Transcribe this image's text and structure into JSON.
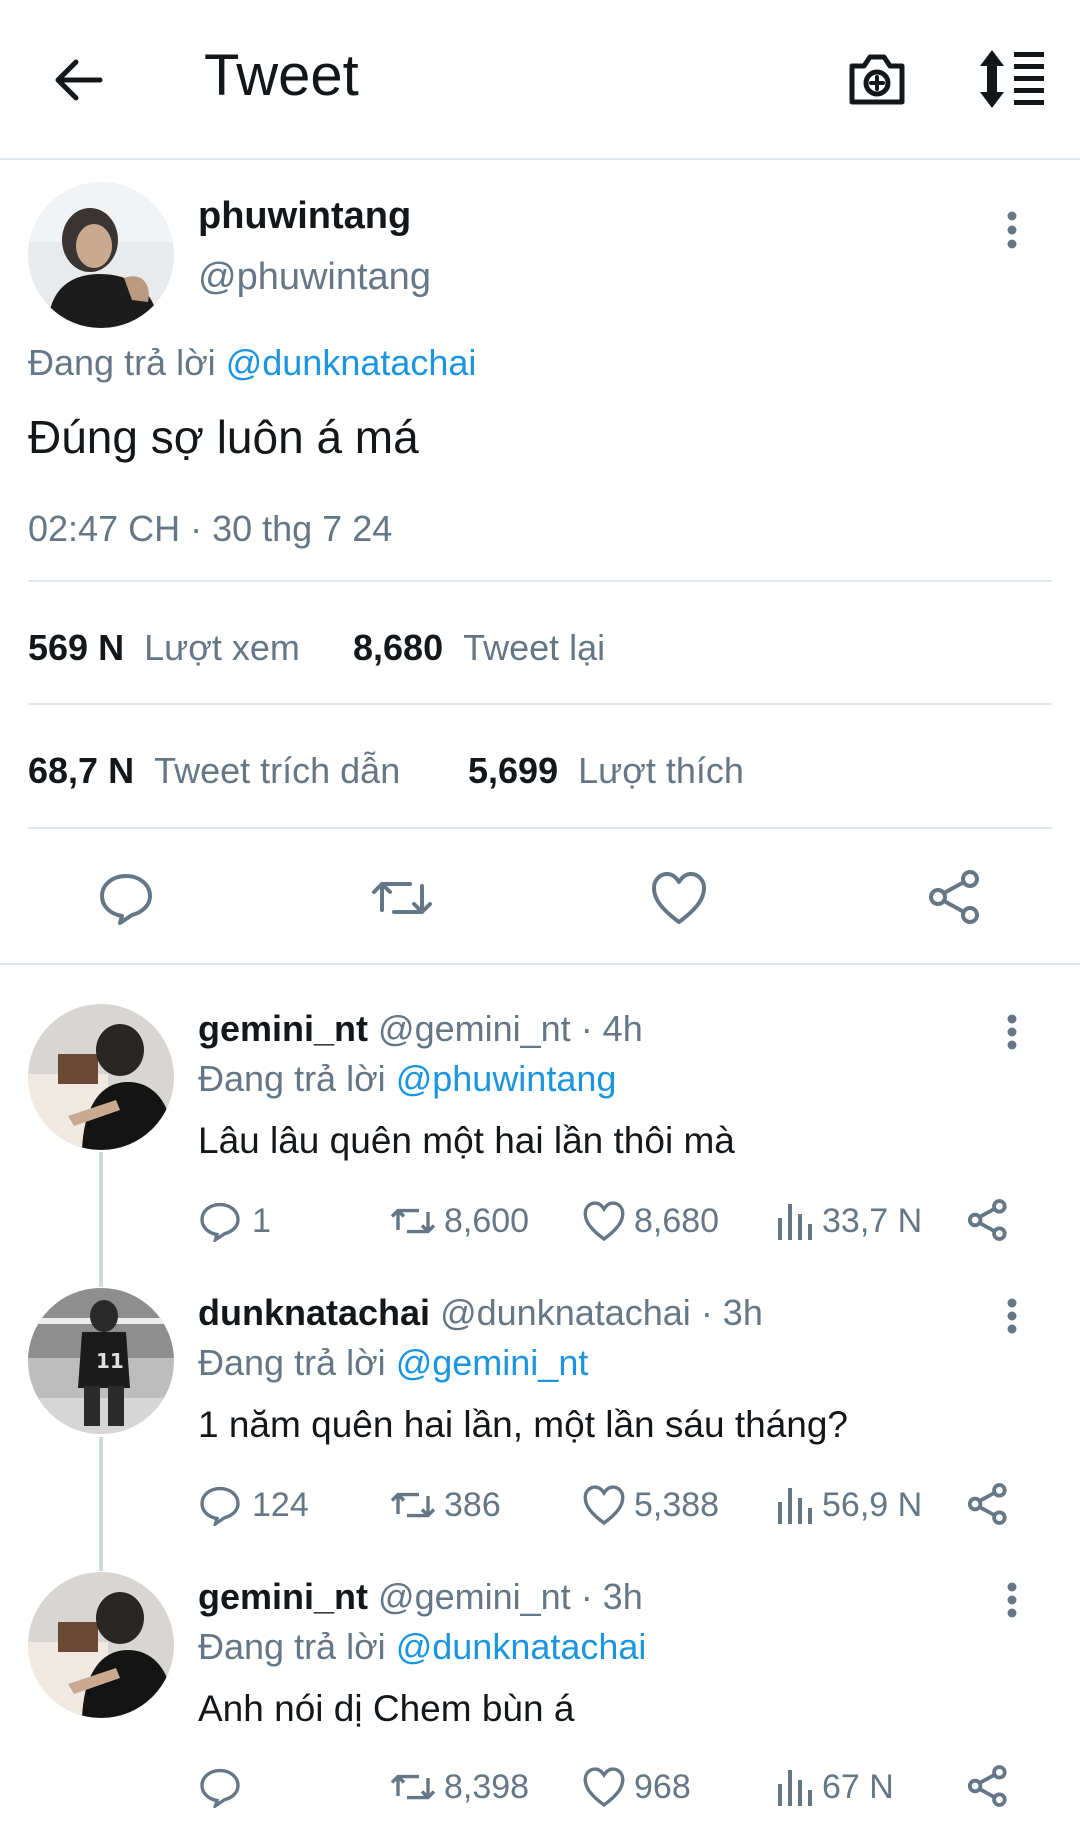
{
  "header": {
    "title": "Tweet",
    "back_icon": "arrow-left-icon",
    "camera_icon": "camera-add-icon",
    "sort_icon": "sort-list-icon"
  },
  "main_tweet": {
    "display_name": "phuwintang",
    "handle": "@phuwintang",
    "replying_label": "Đang trả lời",
    "replying_to": "@dunknatachai",
    "text": "Đúng sợ luôn á má",
    "timestamp": "02:47 CH · 30 thg 7 24",
    "stats": [
      {
        "value": "569 N",
        "label": "Lượt xem"
      },
      {
        "value": "8,680",
        "label": "Tweet lại"
      },
      {
        "value": "68,7 N",
        "label": "Tweet trích dẫn"
      },
      {
        "value": "5,699",
        "label": "Lượt thích"
      }
    ],
    "actions": [
      "reply-icon",
      "retweet-icon",
      "like-icon",
      "share-icon"
    ]
  },
  "replies": [
    {
      "display_name": "gemini_nt",
      "handle": "@gemini_nt",
      "time": "· 4h",
      "replying_label": "Đang trả lời",
      "replying_to": "@phuwintang",
      "text": "Lâu lâu quên một hai lần thôi mà",
      "reply_count": "1",
      "retweet_count": "8,600",
      "like_count": "8,680",
      "view_count": "33,7 N"
    },
    {
      "display_name": "dunknatachai",
      "handle": "@dunknatachai",
      "time": "· 3h",
      "replying_label": "Đang trả lời",
      "replying_to": "@gemini_nt",
      "text": "1 năm quên hai lần, một lần sáu tháng?",
      "reply_count": "124",
      "retweet_count": "386",
      "like_count": "5,388",
      "view_count": "56,9 N"
    },
    {
      "display_name": "gemini_nt",
      "handle": "@gemini_nt",
      "time": "· 3h",
      "replying_label": "Đang trả lời",
      "replying_to": "@dunknatachai",
      "text": "Anh nói dị Chem bùn á",
      "reply_count": "",
      "retweet_count": "8,398",
      "like_count": "968",
      "view_count": "67 N"
    }
  ],
  "colors": {
    "link": "#1b95e0",
    "muted": "#657786",
    "divider": "#e1e8ed",
    "text": "#14171a"
  }
}
